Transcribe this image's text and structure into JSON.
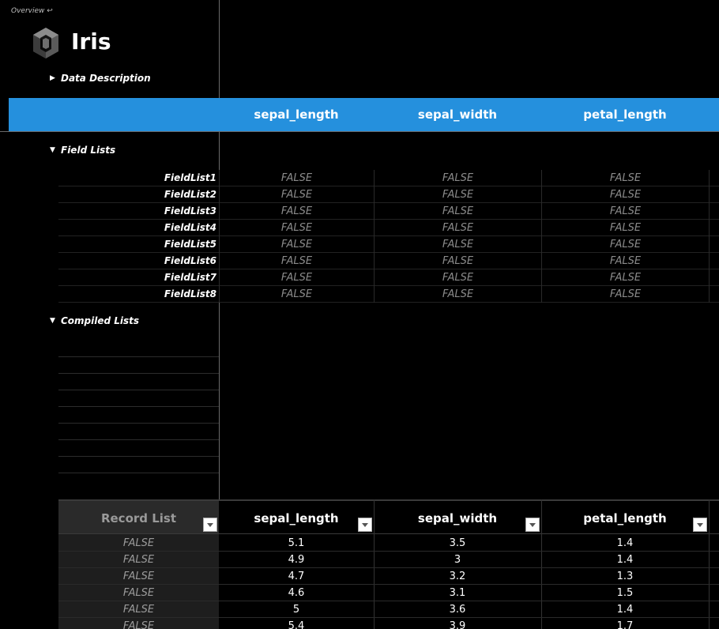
{
  "nav": {
    "overview_label": "Overview ↩"
  },
  "app": {
    "title": "Iris",
    "logo_icon": "hexagon-cube-logo"
  },
  "sections": {
    "data_description": "Data Description",
    "field_lists": "Field Lists",
    "compiled_lists": "Compiled Lists"
  },
  "columns": [
    "sepal_length",
    "sepal_width",
    "petal_length"
  ],
  "field_lists": [
    {
      "label": "FieldList1",
      "values": [
        "FALSE",
        "FALSE",
        "FALSE"
      ]
    },
    {
      "label": "FieldList2",
      "values": [
        "FALSE",
        "FALSE",
        "FALSE"
      ]
    },
    {
      "label": "FieldList3",
      "values": [
        "FALSE",
        "FALSE",
        "FALSE"
      ]
    },
    {
      "label": "FieldList4",
      "values": [
        "FALSE",
        "FALSE",
        "FALSE"
      ]
    },
    {
      "label": "FieldList5",
      "values": [
        "FALSE",
        "FALSE",
        "FALSE"
      ]
    },
    {
      "label": "FieldList6",
      "values": [
        "FALSE",
        "FALSE",
        "FALSE"
      ]
    },
    {
      "label": "FieldList7",
      "values": [
        "FALSE",
        "FALSE",
        "FALSE"
      ]
    },
    {
      "label": "FieldList8",
      "values": [
        "FALSE",
        "FALSE",
        "FALSE"
      ]
    }
  ],
  "record_list": {
    "header": "Record List",
    "columns": [
      "sepal_length",
      "sepal_width",
      "petal_length"
    ],
    "rows": [
      {
        "flag": "FALSE",
        "values": [
          "5.1",
          "3.5",
          "1.4"
        ]
      },
      {
        "flag": "FALSE",
        "values": [
          "4.9",
          "3",
          "1.4"
        ]
      },
      {
        "flag": "FALSE",
        "values": [
          "4.7",
          "3.2",
          "1.3"
        ]
      },
      {
        "flag": "FALSE",
        "values": [
          "4.6",
          "3.1",
          "1.5"
        ]
      },
      {
        "flag": "FALSE",
        "values": [
          "5",
          "3.6",
          "1.4"
        ]
      },
      {
        "flag": "FALSE",
        "values": [
          "5.4",
          "3.9",
          "1.7"
        ]
      }
    ]
  },
  "colors": {
    "header_band": "#2590dd",
    "background": "#000000",
    "false_text": "#8a8a8a"
  }
}
